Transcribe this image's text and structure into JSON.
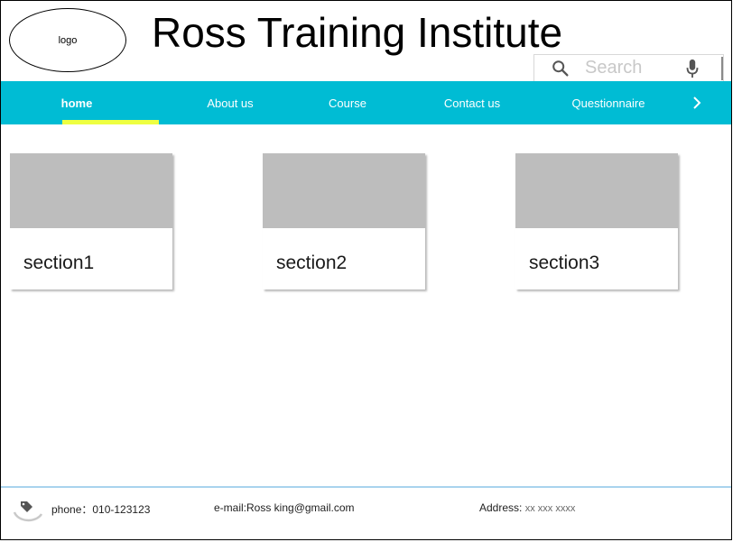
{
  "header": {
    "logo_label": "logo",
    "title": "Ross Training Institute",
    "search_placeholder": "Search"
  },
  "nav": {
    "items": [
      {
        "label": "home"
      },
      {
        "label": "About us"
      },
      {
        "label": "Course"
      },
      {
        "label": "Contact us"
      },
      {
        "label": "Questionnaire"
      }
    ],
    "active": "home",
    "accent_color": "#00bcd4",
    "indicator_color": "#eeff41"
  },
  "cards": [
    {
      "title": "section1"
    },
    {
      "title": "section2"
    },
    {
      "title": "section3"
    }
  ],
  "footer": {
    "phone": "phone：010-123123",
    "email": "e-mail:Ross  king@gmail.com",
    "address_label": "Address:",
    "address_value": "xx xxx xxxx"
  },
  "icons": {
    "search": "search-icon",
    "mic": "mic-icon",
    "next": "chevron-right-icon",
    "footer": "tag-icon"
  }
}
